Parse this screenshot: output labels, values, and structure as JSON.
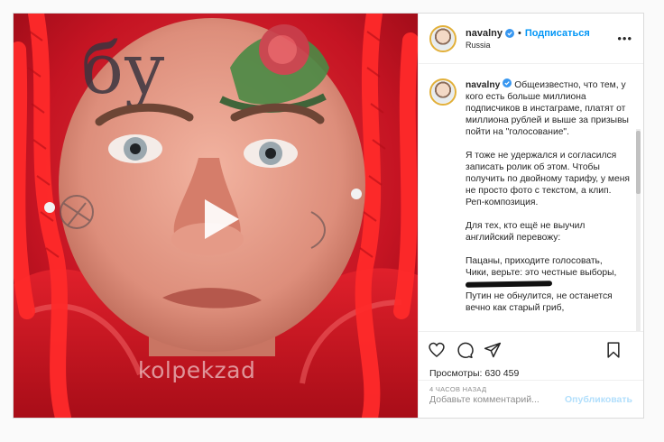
{
  "post": {
    "username": "navalny",
    "follow_label": "Подписаться",
    "dot": "•",
    "location": "Russia",
    "more_label": "•••",
    "watermark": "kolpekzad"
  },
  "caption": {
    "username": "navalny",
    "paragraphs": [
      "Общеизвестно, что тем, у кого есть больше миллиона подписчиков в инстаграме, платят от миллиона рублей и выше за призывы пойти на \"голосование\".",
      "Я тоже не удержался и согласился записать ролик об этом. Чтобы получить по двойному тарифу, у меня не просто фото с текстом, а клип. Реп-композиция.",
      "Для тех, кто ещё не выучил английский перевожу:"
    ],
    "verse": [
      "Пацаны, приходите голосовать,",
      "Чики, верьте: это честные выборы,",
      "Путин не обнулится, не останется",
      "вечно как старый гриб,"
    ]
  },
  "stats": {
    "views_label": "Просмотры:",
    "views_count": "630 459",
    "time": "4 ЧАСОВ НАЗАД"
  },
  "comment": {
    "placeholder": "Добавьте комментарий...",
    "publish_label": "Опубликовать"
  },
  "icons": [
    "heart-icon",
    "comment-icon",
    "share-icon",
    "bookmark-icon",
    "play-icon",
    "verified-icon",
    "more-icon"
  ],
  "colors": {
    "accent": "#0095f6",
    "publish_disabled": "#b2dffc",
    "verified": "#3897f0"
  }
}
